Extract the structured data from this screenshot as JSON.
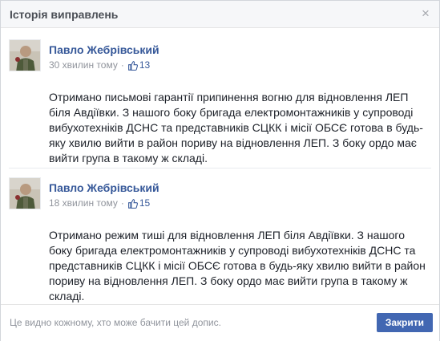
{
  "dialog": {
    "title": "Історія виправлень",
    "close_icon": "close-icon"
  },
  "entries": [
    {
      "author": "Павло Жебрівський",
      "time": "30 хвилин тому",
      "likes": "13",
      "text": "Отримано письмові гарантії припинення вогню для відновлення ЛЕП біля Авдіївки. З нашого боку бригада електромонтажників у супроводі вибухотехніків ДСНС та представників СЦКК і місії ОБСЄ готова в будь-яку хвилю вийти в район пориву на відновлення ЛЕП. З боку ордо має вийти група в такому ж складі."
    },
    {
      "author": "Павло Жебрівський",
      "time": "18 хвилин тому",
      "likes": "15",
      "text": "Отримано режим тиші для відновлення ЛЕП біля Авдіївки. З нашого боку бригада електромонтажників у супроводі вибухотехніків ДСНС та представників СЦКК і місії ОБСЄ готова в будь-яку хвилю вийти в район пориву на відновлення ЛЕП. З боку ордо має вийти група в такому ж складі."
    }
  ],
  "footer": {
    "note": "Це видно кожному, хто може бачити цей допис.",
    "close_label": "Закрити"
  },
  "colors": {
    "accent": "#4267b2",
    "link": "#365899",
    "muted": "#90949c"
  }
}
